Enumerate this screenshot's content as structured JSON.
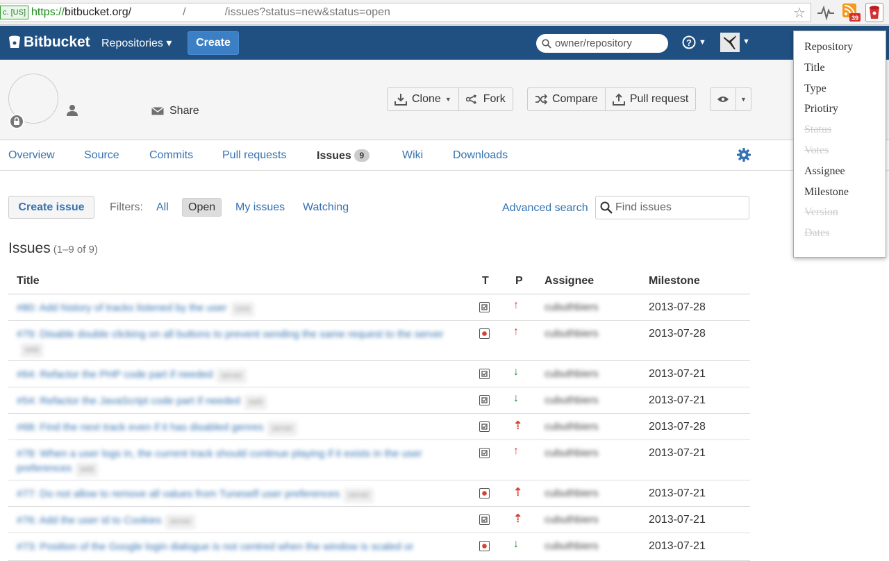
{
  "browser": {
    "ev_label": "c. [US]",
    "url_scheme": "https://",
    "url_host": "bitbucket.org/",
    "url_sep1": "/",
    "url_path": "/issues?status=new&status=open",
    "rss_count": "39"
  },
  "header": {
    "brand": "Bitbucket",
    "repositories": "Repositories ▾",
    "create": "Create",
    "search_placeholder": "owner/repository",
    "help": "? ▾"
  },
  "repo": {
    "share": "Share",
    "clone": "Clone",
    "fork": "Fork",
    "compare": "Compare",
    "pull_request": "Pull request"
  },
  "tabs": [
    {
      "label": "Overview"
    },
    {
      "label": "Source"
    },
    {
      "label": "Commits"
    },
    {
      "label": "Pull requests"
    },
    {
      "label": "Issues",
      "badge": "9"
    },
    {
      "label": "Wiki"
    },
    {
      "label": "Downloads"
    }
  ],
  "toolbar": {
    "create_issue": "Create issue",
    "filters_label": "Filters:",
    "filter_all": "All",
    "filter_open": "Open",
    "filter_mine": "My issues",
    "filter_watching": "Watching",
    "advanced_search": "Advanced search",
    "find_placeholder": "Find issues"
  },
  "issues": {
    "heading": "Issues",
    "count": "(1–9 of 9)",
    "columns": {
      "title": "Title",
      "type": "T",
      "priority": "P",
      "assignee": "Assignee",
      "milestone": "Milestone"
    },
    "rows": [
      {
        "title": "#80: Add history of tracks listened by the user",
        "component": "core",
        "type": "enhancement",
        "priority": "major",
        "assignee": "cubuthbiers",
        "milestone": "2013-07-28"
      },
      {
        "title": "#79: Disable double clicking on all buttons to prevent sending the same request to the server",
        "component": "web",
        "type": "bug",
        "priority": "major",
        "assignee": "cubuthbiers",
        "milestone": "2013-07-28"
      },
      {
        "title": "#64: Refactor the PHP code part if needed",
        "component": "server",
        "type": "enhancement",
        "priority": "minor",
        "assignee": "cubuthbiers",
        "milestone": "2013-07-21"
      },
      {
        "title": "#54: Refactor the JavaScript code part if needed",
        "component": "web",
        "type": "enhancement",
        "priority": "minor",
        "assignee": "cubuthbiers",
        "milestone": "2013-07-21"
      },
      {
        "title": "#68: Find the next track even if it has disabled genres",
        "component": "server",
        "type": "enhancement",
        "priority": "critical",
        "assignee": "cubuthbiers",
        "milestone": "2013-07-28"
      },
      {
        "title": "#78: When a user logs in, the current track should continue playing if it exists in the user preferences",
        "component": "web",
        "type": "enhancement",
        "priority": "major",
        "assignee": "cubuthbiers",
        "milestone": "2013-07-21"
      },
      {
        "title": "#77: Do not allow to remove all values from Tuneself user preferences",
        "component": "server",
        "type": "bug",
        "priority": "critical",
        "assignee": "cubuthbiers",
        "milestone": "2013-07-21"
      },
      {
        "title": "#76: Add the user id to Cookies",
        "component": "server",
        "type": "enhancement",
        "priority": "critical",
        "assignee": "cubuthbiers",
        "milestone": "2013-07-21"
      },
      {
        "title": "#73: Position of the Google login dialogue is not centred when the window is scaled or",
        "component": "",
        "type": "bug",
        "priority": "minor",
        "assignee": "cubuthbiers",
        "milestone": "2013-07-21"
      }
    ]
  },
  "column_popup": {
    "options": [
      {
        "label": "Repository",
        "enabled": true
      },
      {
        "label": "Title",
        "enabled": true
      },
      {
        "label": "Type",
        "enabled": true
      },
      {
        "label": "Priotiry",
        "enabled": true
      },
      {
        "label": "Status",
        "enabled": false
      },
      {
        "label": "Votes",
        "enabled": false
      },
      {
        "label": "Assignee",
        "enabled": true
      },
      {
        "label": "Milestone",
        "enabled": true
      },
      {
        "label": "Version",
        "enabled": false
      },
      {
        "label": "Dates",
        "enabled": false
      }
    ]
  },
  "colors": {
    "header_bg": "#205081",
    "link": "#3572b0",
    "bug": "#d04437",
    "major_up": "#d04437",
    "minor_down": "#14892c"
  }
}
